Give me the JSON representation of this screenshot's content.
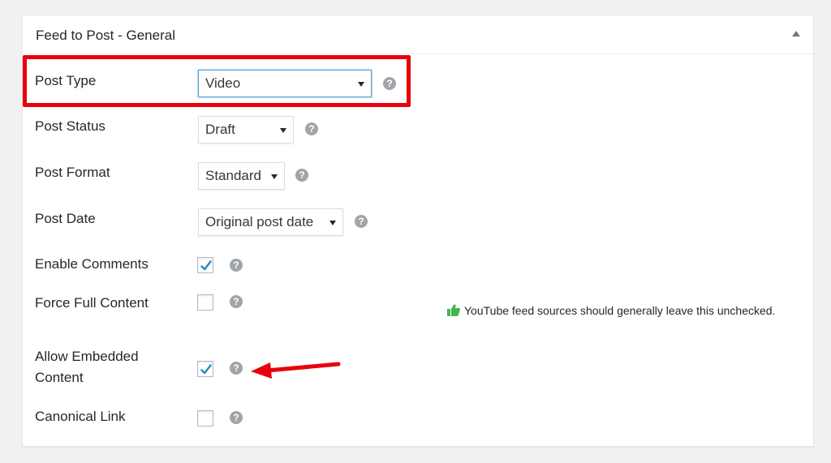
{
  "panel": {
    "title": "Feed to Post - General"
  },
  "rows": {
    "post_type": {
      "label": "Post Type",
      "value": "Video"
    },
    "post_status": {
      "label": "Post Status",
      "value": "Draft"
    },
    "post_format": {
      "label": "Post Format",
      "value": "Standard"
    },
    "post_date": {
      "label": "Post Date",
      "value": "Original post date"
    },
    "enable_comments": {
      "label": "Enable Comments",
      "checked": true
    },
    "force_full_content": {
      "label": "Force Full Content",
      "checked": false
    },
    "allow_embedded_content": {
      "label_line1": "Allow Embedded",
      "label_line2": "Content",
      "checked": true
    },
    "canonical_link": {
      "label": "Canonical Link",
      "checked": false
    }
  },
  "notice": {
    "text": "YouTube feed sources should generally leave this unchecked.",
    "icon": "thumbs-up-icon"
  },
  "help_glyph": "?",
  "colors": {
    "highlight": "#e8000b",
    "checkmark": "#1e8cbe",
    "notice_icon": "#46b450",
    "arrow": "#e8000b"
  }
}
